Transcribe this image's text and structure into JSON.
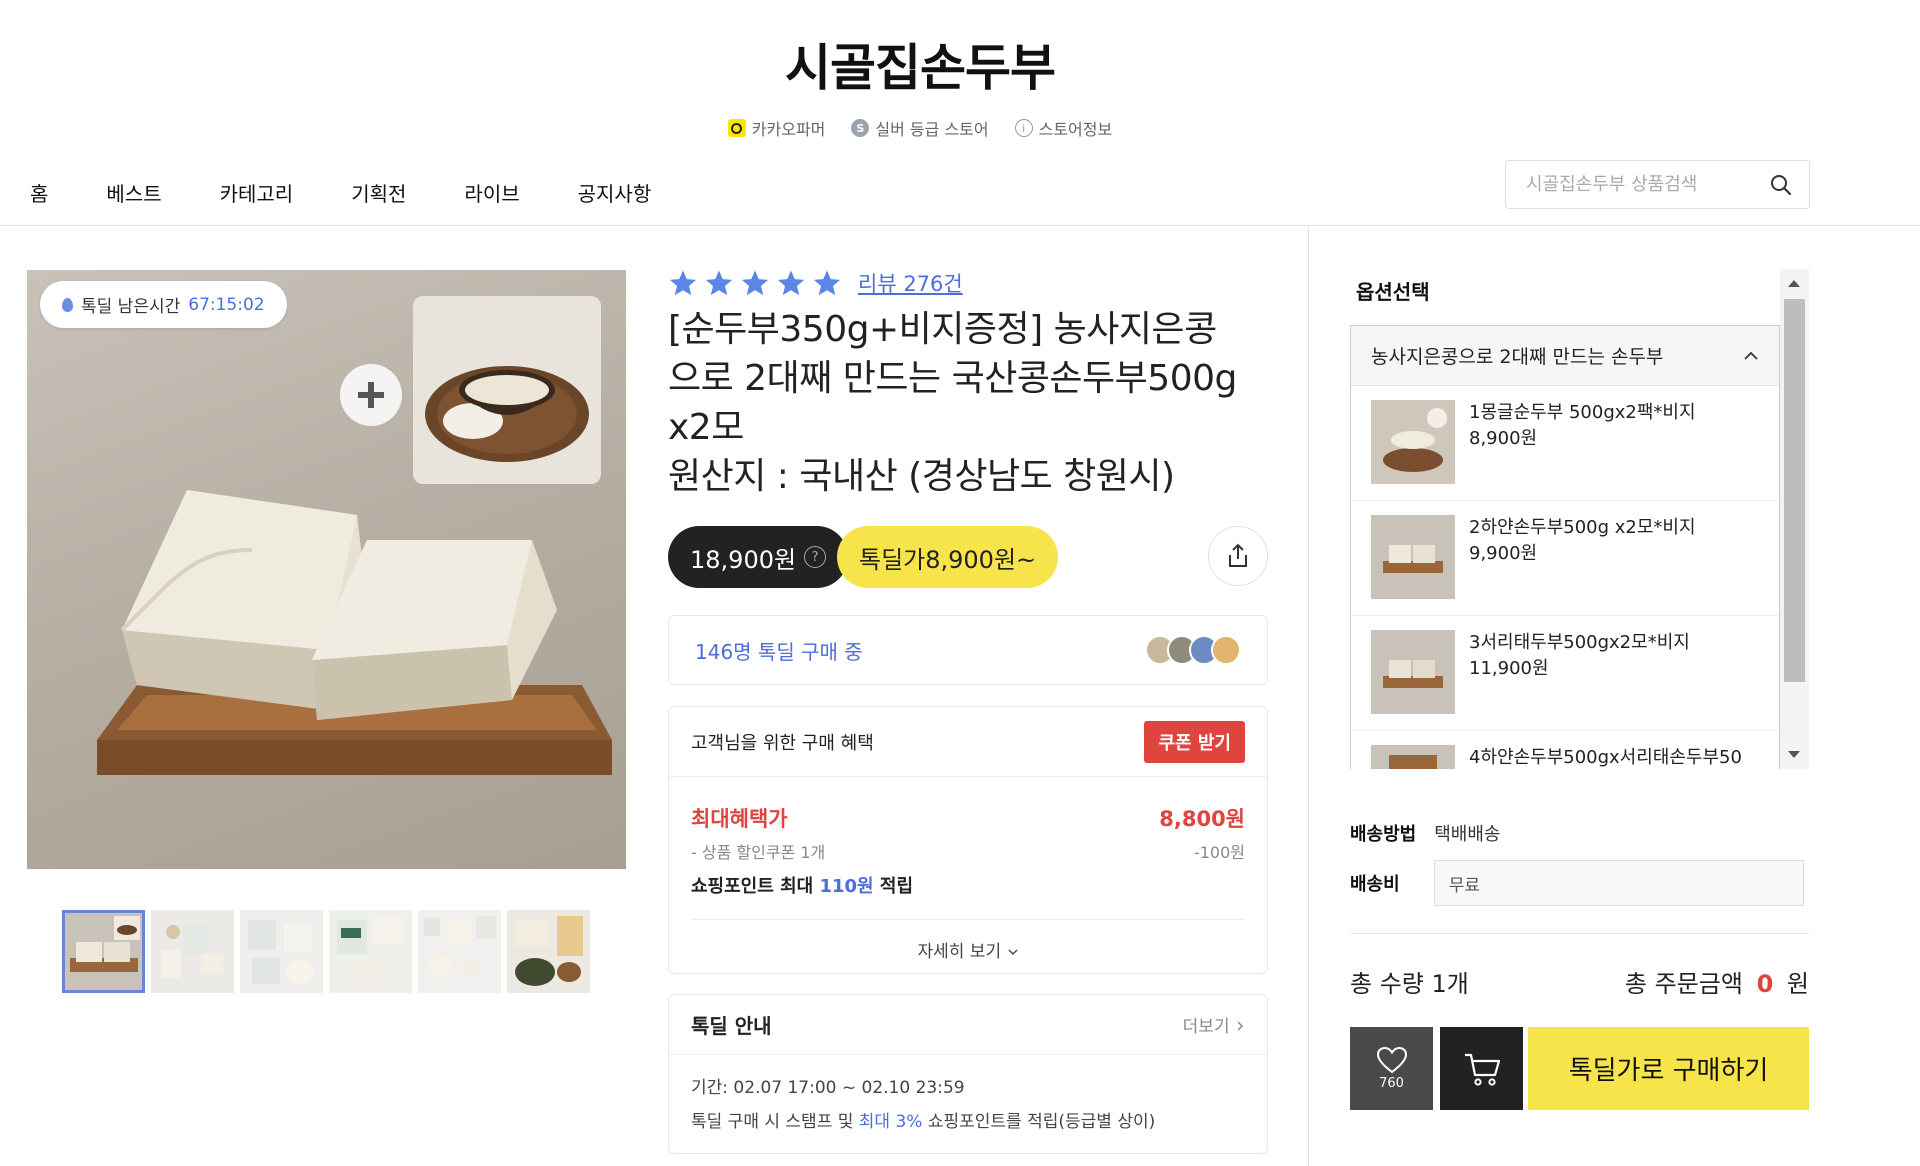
{
  "store": {
    "name": "시골집손두부",
    "meta": [
      {
        "icon": "kakao-farmer-icon",
        "label": "카카오파머"
      },
      {
        "icon": "silver-grade-icon",
        "label": "실버 등급 스토어"
      },
      {
        "icon": "info-icon",
        "label": "스토어정보"
      }
    ]
  },
  "nav": {
    "items": [
      "홈",
      "베스트",
      "카테고리",
      "기획전",
      "라이브",
      "공지사항"
    ]
  },
  "search": {
    "placeholder": "시골집손두부 상품검색"
  },
  "gallery": {
    "timer_label": "톡딜 남은시간",
    "timer_value": "67:15:02",
    "thumbnail_count": 6
  },
  "product": {
    "rating_stars": 5,
    "review_label": "리뷰 276건",
    "title_line1": "[순두부350g+비지증정] 농사지은콩",
    "title_line2": "으로 2대째 만드는 국산콩손두부500g",
    "title_line3": "x2모",
    "title_line4": "원산지 : 국내산 (경상남도 창원시)",
    "regular_price": "18,900원",
    "deal_price": "톡딜가8,900원~",
    "buyers_text": "146명 톡딜 구매 중"
  },
  "benefit": {
    "header": "고객님을 위한 구매 혜택",
    "coupon_button": "쿠폰 받기",
    "max_label": "최대혜택가",
    "max_value": "8,800원",
    "coupon_label": "- 상품 할인쿠폰 1개",
    "coupon_value": "-100원",
    "point_prefix": "쇼핑포인트 최대",
    "point_value": "110원",
    "point_suffix": "적립",
    "more_detail": "자세히 보기"
  },
  "deal_info": {
    "title": "톡딜 안내",
    "more": "더보기",
    "period": "기간: 02.07 17:00 ~ 02.10 23:59",
    "desc_prefix": "톡딜 구매 시 스탬프 및",
    "desc_highlight": "최대 3%",
    "desc_suffix": "쇼핑포인트를 적립(등급별 상이)"
  },
  "options": {
    "title": "옵션선택",
    "selected": "농사지은콩으로 2대째 만드는 손두부",
    "items": [
      {
        "name": "1몽글순두부 500gx2팩*비지",
        "price": "8,900원"
      },
      {
        "name": "2하얀손두부500g x2모*비지",
        "price": "9,900원"
      },
      {
        "name": "3서리태두부500gx2모*비지",
        "price": "11,900원"
      },
      {
        "name": "4하얀손두부500gx서리태손두부50",
        "price": ""
      }
    ]
  },
  "shipping": {
    "method_label": "배송방법",
    "method_value": "택배배송",
    "fee_label": "배송비",
    "fee_value": "무료"
  },
  "summary": {
    "qty_text": "총 수량 1개",
    "amount_prefix": "총 주문금액",
    "amount_value": "0",
    "amount_unit": "원"
  },
  "actions": {
    "like_count": "760",
    "buy_label": "톡딜가로 구매하기"
  },
  "colors": {
    "accent_yellow": "#f7e34a",
    "link_blue": "#4a6fd8",
    "red": "#e0443e"
  }
}
